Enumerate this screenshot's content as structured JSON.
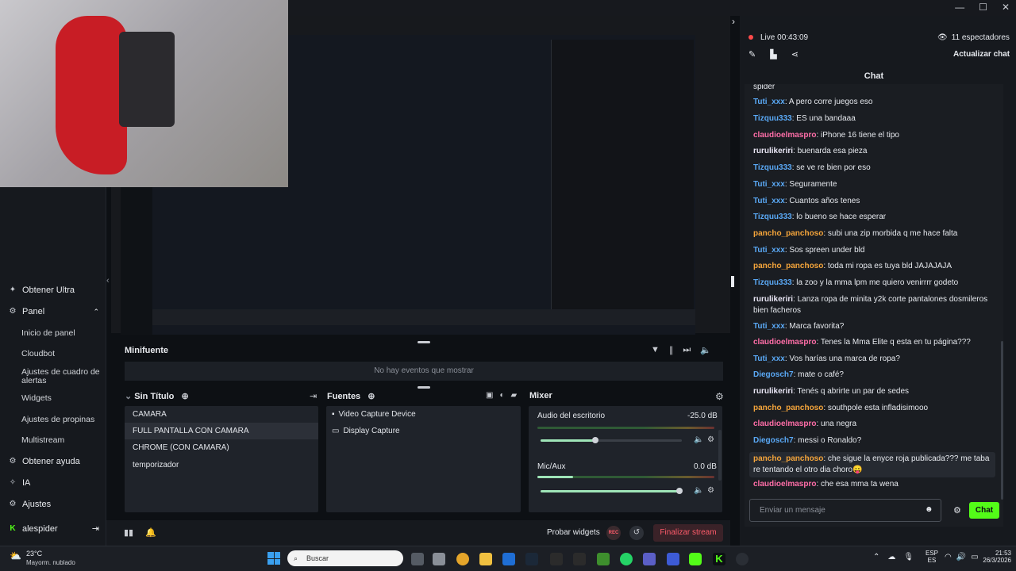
{
  "colors": {
    "accent_green": "#53fc18",
    "finish_red": "#ff5b6a",
    "name_blue": "#5aa9f6",
    "name_orange": "#f5a53b",
    "name_pink": "#ff6ea8",
    "name_white": "#e9e6f5"
  },
  "window": {
    "controls": [
      "—",
      "☐",
      "✕"
    ]
  },
  "sidebar": {
    "get_ultra": "Obtener Ultra",
    "panel": "Panel",
    "panel_items": [
      "Inicio de panel",
      "Cloudbot",
      "Ajustes de cuadro de alertas",
      "Widgets",
      "Ajustes de propinas",
      "Multistream"
    ],
    "get_help": "Obtener ayuda",
    "ai": "IA",
    "settings": "Ajustes",
    "username": "alespider"
  },
  "minifuente": {
    "title": "Minifuente",
    "empty": "No hay eventos que mostrar"
  },
  "scenes": {
    "title": "Sin Título",
    "items": [
      "CAMARA",
      "FULL PANTALLA CON CAMARA",
      "CHROME (CON CAMARA)",
      "temporizador"
    ],
    "selected": 1
  },
  "sources": {
    "title": "Fuentes",
    "items": [
      {
        "icon": "camera-icon",
        "label": "Video Capture Device"
      },
      {
        "icon": "monitor-icon",
        "label": "Display Capture"
      }
    ]
  },
  "mixer": {
    "title": "Mixer",
    "channels": [
      {
        "name": "Audio del escritorio",
        "db": "-25.0 dB",
        "level": 0.42,
        "volume": 0.39
      },
      {
        "name": "Mic/Aux",
        "db": "0.0 dB",
        "level": 0.25,
        "volume": 1.0
      }
    ]
  },
  "footer": {
    "test_widgets": "Probar widgets",
    "rec": "REC",
    "finish": "Finalizar stream"
  },
  "stream": {
    "live": "Live",
    "time": "00:43:09",
    "viewers": "11 espectadores",
    "refresh_chat": "Actualizar chat"
  },
  "chat": {
    "title": "Chat",
    "partial_top": "spider",
    "messages": [
      {
        "user": "Tuti_xxx",
        "color": "#5aa9f6",
        "text": "A pero corre juegos eso"
      },
      {
        "user": "Tizquu333",
        "color": "#5aa9f6",
        "text": "ES una bandaaa"
      },
      {
        "user": "claudioelmaspro",
        "color": "#ff6ea8",
        "text": "iPhone 16 tiene el tipo"
      },
      {
        "user": "rurulikeriri",
        "color": "#e9e6f5",
        "text": "buenarda esa pieza"
      },
      {
        "user": "Tizquu333",
        "color": "#5aa9f6",
        "text": "se ve re bien por eso"
      },
      {
        "user": "Tuti_xxx",
        "color": "#5aa9f6",
        "text": "Seguramente"
      },
      {
        "user": "Tuti_xxx",
        "color": "#5aa9f6",
        "text": "Cuantos años tenes"
      },
      {
        "user": "Tizquu333",
        "color": "#5aa9f6",
        "text": "lo bueno se hace esperar"
      },
      {
        "user": "pancho_panchoso",
        "color": "#f5a53b",
        "text": "subi una zip morbida q me hace falta"
      },
      {
        "user": "Tuti_xxx",
        "color": "#5aa9f6",
        "text": "Sos spreen under bld"
      },
      {
        "user": "pancho_panchoso",
        "color": "#f5a53b",
        "text": "toda mi ropa es tuya bld JAJAJAJA"
      },
      {
        "user": "Tizquu333",
        "color": "#5aa9f6",
        "text": "la zoo y la mma lpm me quiero venirrrr godeto"
      },
      {
        "user": "rurulikeriri",
        "color": "#e9e6f5",
        "text": "Lanza ropa de minita y2k corte pantalones dosmileros bien facheros"
      },
      {
        "user": "Tuti_xxx",
        "color": "#5aa9f6",
        "text": "Marca favorita?"
      },
      {
        "user": "claudioelmaspro",
        "color": "#ff6ea8",
        "text": "Tenes la Mma Elite q esta en tu página???"
      },
      {
        "user": "Tuti_xxx",
        "color": "#5aa9f6",
        "text": "Vos harías una marca de ropa?"
      },
      {
        "user": "Diegosch7",
        "color": "#5aa9f6",
        "text": "mate o café?"
      },
      {
        "user": "rurulikeriri",
        "color": "#e9e6f5",
        "text": "Tenés q abrirte un par de sedes"
      },
      {
        "user": "pancho_panchoso",
        "color": "#f5a53b",
        "text": "southpole esta infladisimooo"
      },
      {
        "user": "claudioelmaspro",
        "color": "#ff6ea8",
        "text": "una negra"
      },
      {
        "user": "Diegosch7",
        "color": "#5aa9f6",
        "text": "messi o Ronaldo?"
      },
      {
        "user": "pancho_panchoso",
        "color": "#f5a53b",
        "text": "che sigue la enyce roja publicada??? me taba re tentando el otro dia choro😛"
      },
      {
        "user": "claudioelmaspro",
        "color": "#ff6ea8",
        "text": "che esa mma ta wena"
      }
    ],
    "input_placeholder": "Enviar un mensaje",
    "send": "Chat"
  },
  "taskbar": {
    "temp": "23°C",
    "weather": "Mayorm. nublado",
    "search": "Buscar",
    "lang": "ESP",
    "lang2": "ES",
    "time": "21:53",
    "date": "26/3/2026"
  }
}
